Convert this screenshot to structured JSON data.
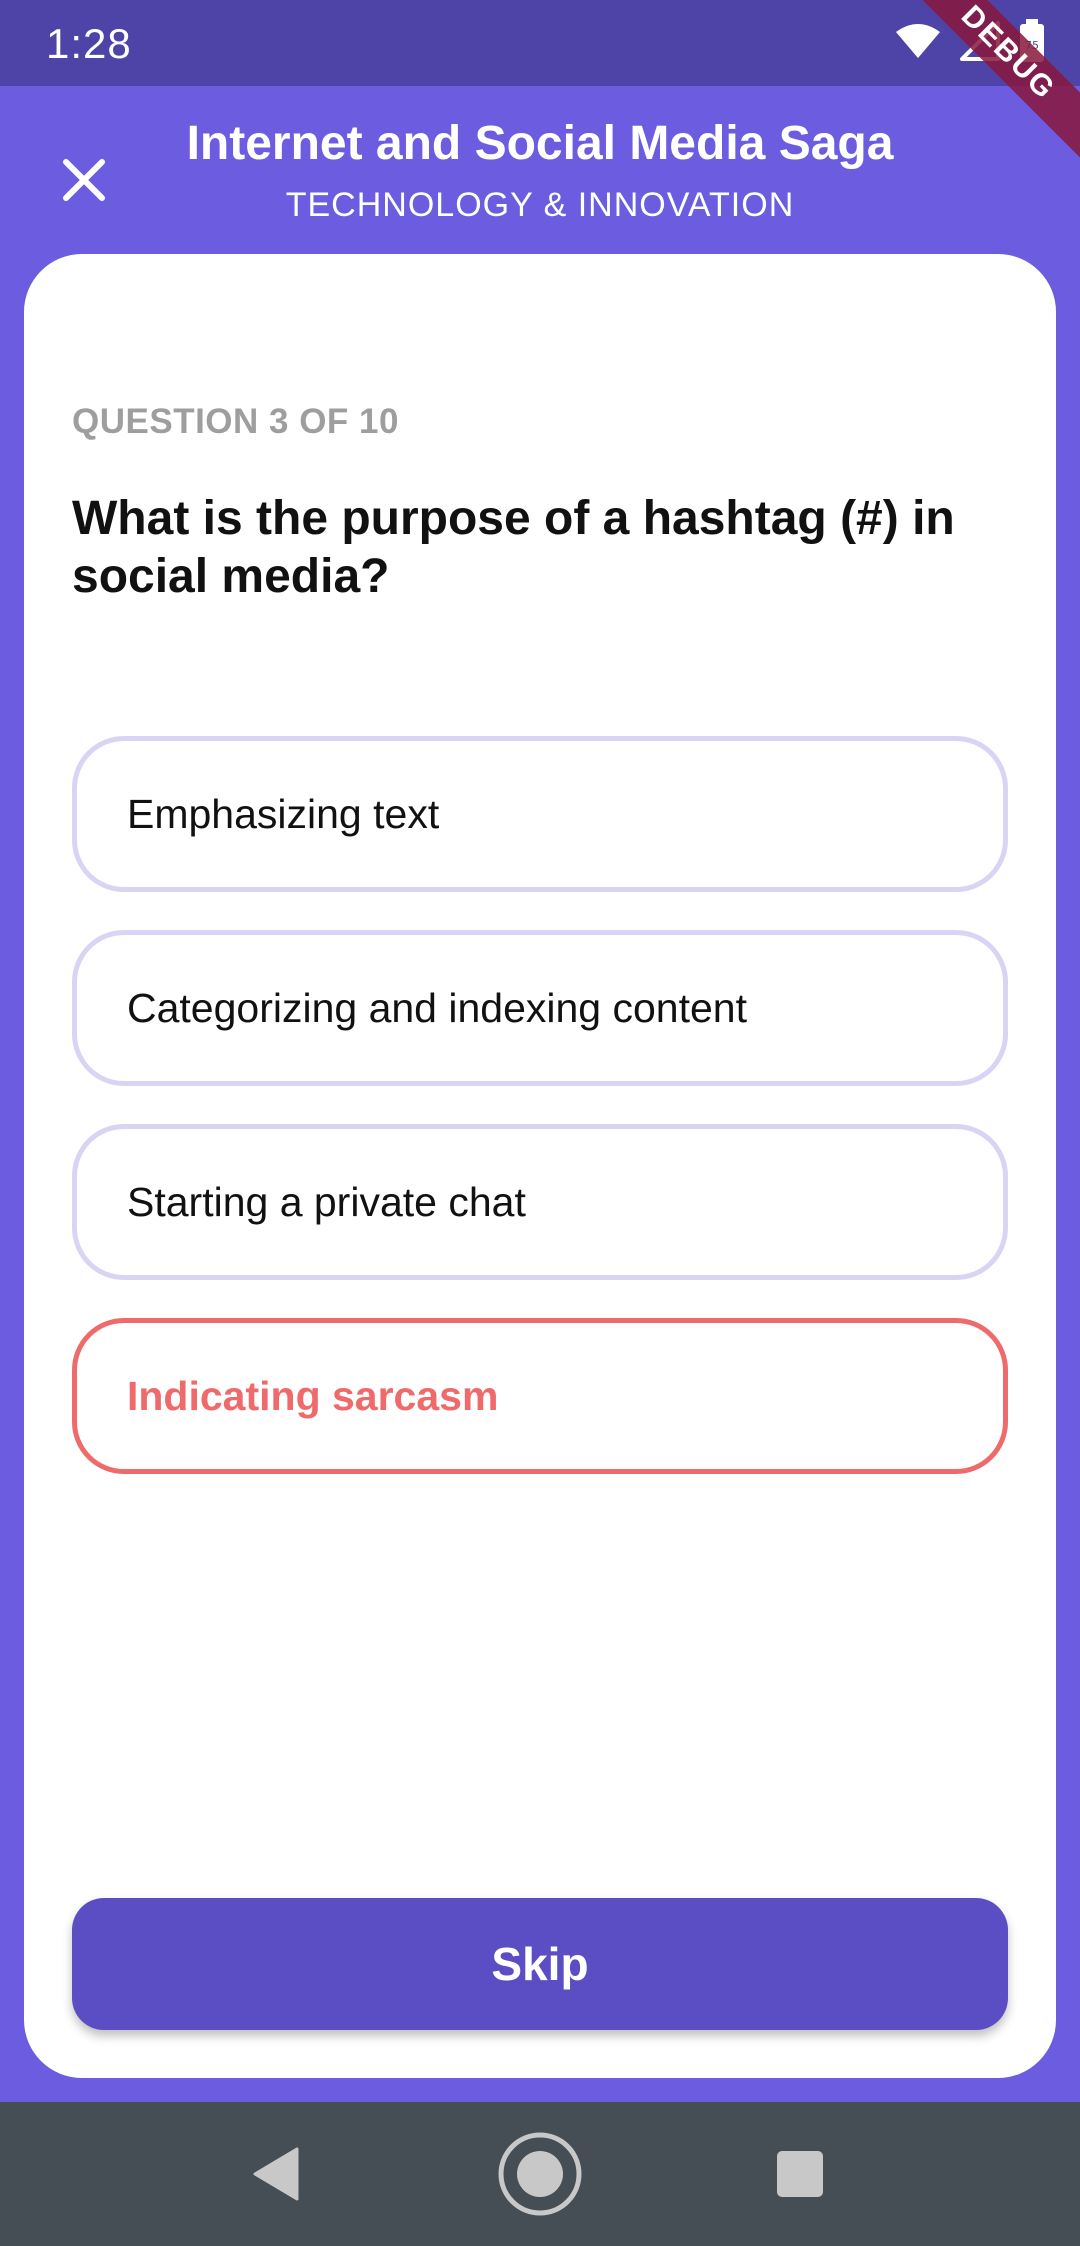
{
  "status_bar": {
    "time": "1:28",
    "battery_level": "75",
    "debug_label": "DEBUG",
    "icons": [
      "wifi-icon",
      "signal-icon",
      "battery-icon"
    ]
  },
  "header": {
    "title": "Internet and Social Media Saga",
    "subtitle": "TECHNOLOGY & INNOVATION",
    "close_icon": "close-icon"
  },
  "quiz": {
    "progress_label": "QUESTION 3 OF 10",
    "current_question": 3,
    "total_questions": 10,
    "question": "What is the purpose of a hashtag (#) in social media?",
    "options": [
      {
        "label": "Emphasizing text",
        "state": "default"
      },
      {
        "label": "Categorizing and indexing content",
        "state": "default"
      },
      {
        "label": "Starting a private chat",
        "state": "default"
      },
      {
        "label": "Indicating sarcasm",
        "state": "wrong"
      }
    ],
    "skip_label": "Skip"
  },
  "nav_bar": {
    "icons": [
      "back-icon",
      "home-icon",
      "recents-icon"
    ]
  },
  "colors": {
    "primary": "#6b5ce0",
    "status_bar": "#4e44a8",
    "button": "#5b4ec4",
    "option_border": "#d8d4f4",
    "wrong": "#ef6b6b",
    "nav_bar": "#454d55"
  }
}
